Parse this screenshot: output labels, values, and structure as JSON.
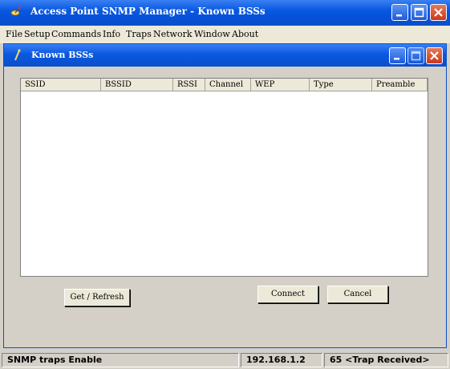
{
  "window": {
    "title": "Access Point SNMP Manager - Known BSSs"
  },
  "menu": [
    "File",
    "Setup",
    "Commands",
    "Info",
    "Traps",
    "Network",
    "Window",
    "About"
  ],
  "child_window": {
    "title": "Known BSSs"
  },
  "table": {
    "columns": [
      "SSID",
      "BSSID",
      "RSSI",
      "Channel",
      "WEP",
      "Type",
      "Preamble"
    ],
    "rows": []
  },
  "buttons": {
    "get_refresh": "Get / Refresh",
    "connect": "Connect",
    "cancel": "Cancel"
  },
  "status": {
    "traps": "SNMP traps Enable",
    "ip": "192.168.1.2",
    "trap_count": "65 <Trap Received>"
  },
  "icons": {
    "app": "satellite-dish-icon",
    "child": "antenna-icon",
    "minimize": "minimize-icon",
    "maximize": "maximize-icon",
    "close": "close-icon"
  },
  "colors": {
    "titlebar": "#0a58e0",
    "close_button": "#c9381b",
    "window_bg": "#d4d0c8"
  }
}
